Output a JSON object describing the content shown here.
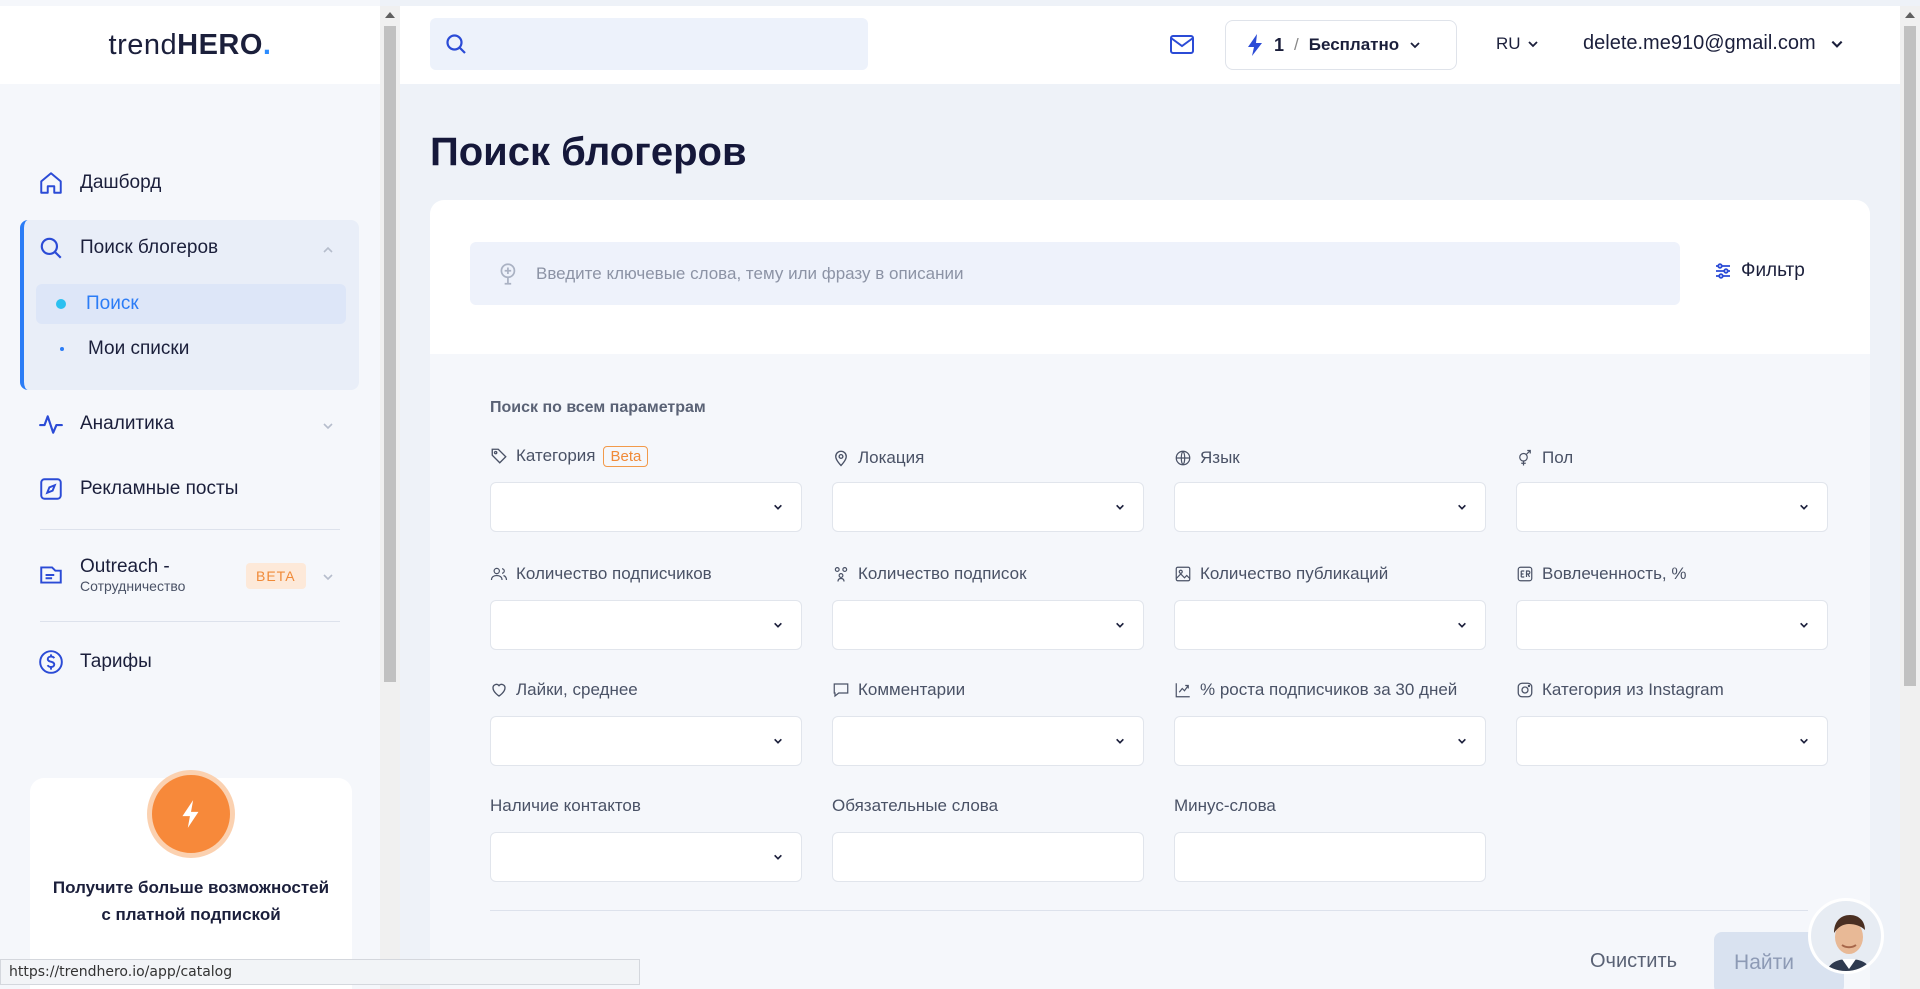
{
  "logo": {
    "part1": "trend",
    "part2": "HERO",
    "dot": "."
  },
  "sidebar": {
    "dashboard": "Дашборд",
    "search_group": "Поиск блогеров",
    "search_sub": "Поиск",
    "lists_sub": "Мои списки",
    "analytics": "Аналитика",
    "ad_posts": "Рекламные посты",
    "outreach": "Outreach -",
    "outreach_sub": "Сотрудничество",
    "outreach_badge": "BETA",
    "tariffs": "Тарифы",
    "promo_text": "Получите больше возможностей с платной подпиской"
  },
  "header": {
    "credits": "1",
    "separator": "/",
    "plan": "Бесплатно",
    "language": "RU",
    "email": "delete.me910@gmail.com"
  },
  "main": {
    "title": "Поиск блогеров",
    "keyword_placeholder": "Введите ключевые слова, тему или фразу в описании",
    "filter_label": "Фильтр",
    "section_label": "Поиск по всем параметрам",
    "fields": {
      "category": "Категория",
      "category_badge": "Beta",
      "location": "Локация",
      "language": "Язык",
      "gender": "Пол",
      "followers": "Количество подписчиков",
      "following": "Количество подписок",
      "posts": "Количество публикаций",
      "engagement": "Вовлеченность, %",
      "likes": "Лайки, среднее",
      "comments": "Комментарии",
      "growth": "% роста подписчиков за 30 дней",
      "ig_category": "Категория из Instagram",
      "contacts": "Наличие контактов",
      "required_words": "Обязательные слова",
      "minus_words": "Минус-слова"
    },
    "clear_label": "Очистить",
    "find_label": "Найти"
  },
  "status_url": "https://trendhero.io/app/catalog",
  "colors": {
    "accent": "#2b7cf6",
    "promo": "#f7893a",
    "title": "#15183a"
  }
}
